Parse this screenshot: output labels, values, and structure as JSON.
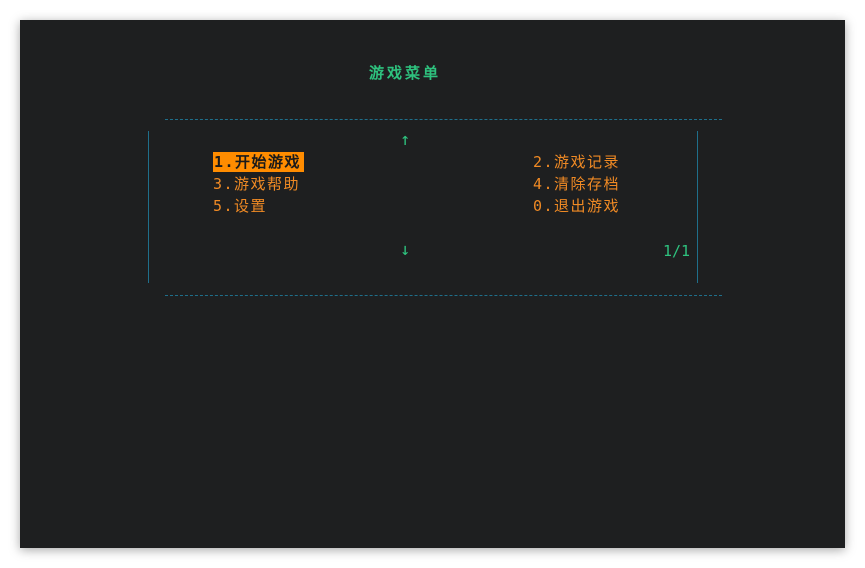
{
  "menu": {
    "title": "游戏菜单",
    "up_arrow": "↑",
    "down_arrow": "↓",
    "page_indicator": "1/1",
    "items": [
      {
        "label": "1.开始游戏"
      },
      {
        "label": "2.游戏记录"
      },
      {
        "label": "3.游戏帮助"
      },
      {
        "label": "4.清除存档"
      },
      {
        "label": "5.设置"
      },
      {
        "label": "0.退出游戏"
      }
    ],
    "selected_item": "1.开始游戏"
  },
  "colors": {
    "background": "#1e1f20",
    "title": "#2ec27e",
    "item_text": "#f08a24",
    "highlight": "#ff8c00",
    "border": "#1f6f8b"
  }
}
